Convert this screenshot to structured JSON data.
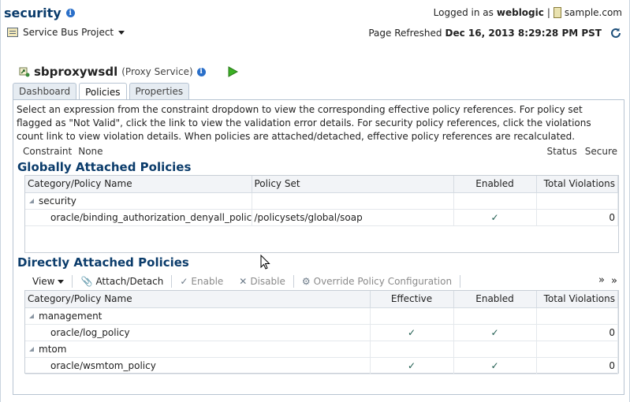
{
  "header": {
    "title": "security",
    "project_menu": "Service Bus Project",
    "logged_in_prefix": "Logged in as",
    "user": "weblogic",
    "user_sep": "|",
    "server": "sample.com",
    "refresh_prefix": "Page Refreshed",
    "refresh_time": "Dec 16, 2013 8:29:28 PM PST"
  },
  "service": {
    "name": "sbproxywsdl",
    "type": "(Proxy Service)"
  },
  "tabs": [
    {
      "label": "Dashboard",
      "active": false
    },
    {
      "label": "Policies",
      "active": true
    },
    {
      "label": "Properties",
      "active": false
    }
  ],
  "description": "Select an expression from the constraint dropdown to view the corresponding effective policy references. For policy set flagged as \"Not Valid\", click the link to view the validation error details. For security policy references, click the violations count link to view violation details. When policies are attached/detached, effective policy references are recalculated.",
  "constraint": {
    "label": "Constraint",
    "value": "None"
  },
  "status": {
    "label": "Status",
    "value": "Secure"
  },
  "global": {
    "title": "Globally Attached Policies",
    "columns": [
      "Category/Policy Name",
      "Policy Set",
      "Enabled",
      "Total Violations"
    ],
    "group": "security",
    "row": {
      "name": "oracle/binding_authorization_denyall_policy",
      "policy_set": "/policysets/global/soap",
      "enabled": "✓",
      "violations": "0"
    }
  },
  "direct": {
    "title": "Directly Attached Policies",
    "toolbar": {
      "view": "View",
      "attach": "Attach/Detach",
      "enable": "Enable",
      "disable": "Disable",
      "override": "Override Policy Configuration",
      "more": "»"
    },
    "columns": [
      "Category/Policy Name",
      "Effective",
      "Enabled",
      "Total Violations"
    ],
    "groups": [
      {
        "name": "management",
        "row": {
          "name": "oracle/log_policy",
          "effective": "✓",
          "enabled": "✓",
          "violations": "0"
        }
      },
      {
        "name": "mtom",
        "row": {
          "name": "oracle/wsmtom_policy",
          "effective": "✓",
          "enabled": "✓",
          "violations": "0"
        }
      }
    ]
  },
  "colors": {
    "title_blue": "#0b3c6b",
    "check_green": "#1d5b4e",
    "run_green": "#3bb024"
  }
}
